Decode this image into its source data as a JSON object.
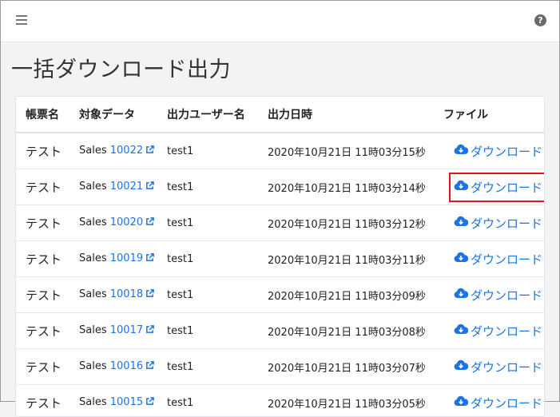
{
  "header": {
    "menu_icon": "hamburger-icon",
    "help_icon": "question-circle-icon",
    "help_glyph": "?"
  },
  "page": {
    "title": "一括ダウンロード出力"
  },
  "table": {
    "columns": [
      "帳票名",
      "対象データ",
      "出力ユーザー名",
      "出力日時",
      "ファイル"
    ],
    "download_label": "ダウンロード",
    "rows": [
      {
        "name": "テスト",
        "prefix": "Sales",
        "id": "10022",
        "user": "test1",
        "datetime": "2020年10月21日 11時03分15秒"
      },
      {
        "name": "テスト",
        "prefix": "Sales",
        "id": "10021",
        "user": "test1",
        "datetime": "2020年10月21日 11時03分14秒"
      },
      {
        "name": "テスト",
        "prefix": "Sales",
        "id": "10020",
        "user": "test1",
        "datetime": "2020年10月21日 11時03分12秒"
      },
      {
        "name": "テスト",
        "prefix": "Sales",
        "id": "10019",
        "user": "test1",
        "datetime": "2020年10月21日 11時03分11秒"
      },
      {
        "name": "テスト",
        "prefix": "Sales",
        "id": "10018",
        "user": "test1",
        "datetime": "2020年10月21日 11時03分09秒"
      },
      {
        "name": "テスト",
        "prefix": "Sales",
        "id": "10017",
        "user": "test1",
        "datetime": "2020年10月21日 11時03分08秒"
      },
      {
        "name": "テスト",
        "prefix": "Sales",
        "id": "10016",
        "user": "test1",
        "datetime": "2020年10月21日 11時03分07秒"
      },
      {
        "name": "テスト",
        "prefix": "Sales",
        "id": "10015",
        "user": "test1",
        "datetime": "2020年10月21日 11時03分05秒"
      }
    ]
  },
  "colors": {
    "link": "#1a73e8",
    "highlight": "#e3131b"
  }
}
